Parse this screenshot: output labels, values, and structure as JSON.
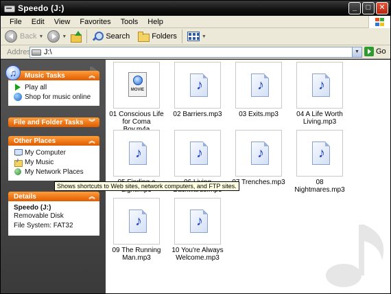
{
  "window": {
    "title": "Speedo (J:)"
  },
  "title_buttons": {
    "minimize": "_",
    "maximize": "□",
    "close": "✕"
  },
  "menu": [
    "File",
    "Edit",
    "View",
    "Favorites",
    "Tools",
    "Help"
  ],
  "toolbar": {
    "back_label": "Back",
    "search_label": "Search",
    "folders_label": "Folders"
  },
  "address": {
    "label": "Address",
    "value": "J:\\",
    "go_label": "Go"
  },
  "left_panel": {
    "music_tasks": {
      "title": "Music Tasks",
      "items": [
        "Play all",
        "Shop for music online"
      ]
    },
    "file_folder_tasks": {
      "title": "File and Folder Tasks"
    },
    "other_places": {
      "title": "Other Places",
      "items": [
        "My Computer",
        "My Music",
        "My Network Places"
      ]
    },
    "details": {
      "title": "Details",
      "name": "Speedo (J:)",
      "type": "Removable Disk",
      "fs": "File System: FAT32"
    }
  },
  "files": [
    {
      "name": "01 Conscious Life for Coma Boy.m4a",
      "kind": "movie",
      "icon_label": "MOVIE"
    },
    {
      "name": "02 Barriers.mp3",
      "kind": "audio"
    },
    {
      "name": "03 Exits.mp3",
      "kind": "audio"
    },
    {
      "name": "04 A Life Worth Living.mp3",
      "kind": "audio"
    },
    {
      "name": "05 Finding a Light.mp3",
      "kind": "audio"
    },
    {
      "name": "06 Living Backwards.mp3",
      "kind": "audio"
    },
    {
      "name": "07 Trenches.mp3",
      "kind": "audio"
    },
    {
      "name": "08 Nightmares.mp3",
      "kind": "audio"
    },
    {
      "name": "09 The Running Man.mp3",
      "kind": "audio"
    },
    {
      "name": "10 You're Always Welcome.mp3",
      "kind": "audio"
    }
  ],
  "tooltip": "Shows shortcuts to Web sites, network computers, and FTP sites.",
  "colors": {
    "panel_header": "#f07a10",
    "accent_blue": "#2a58b8"
  }
}
